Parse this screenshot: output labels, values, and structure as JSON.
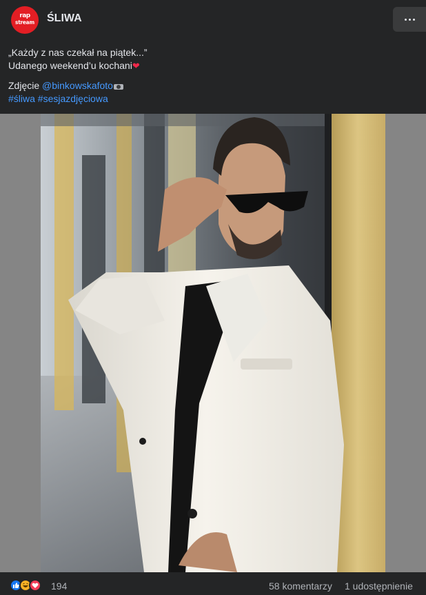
{
  "page": {
    "name": "ŚLIWA",
    "avatar_line1": "rap",
    "avatar_line2": "stream"
  },
  "post": {
    "line1": "„Każdy z nas czekał na piątek...”",
    "line2_text": "Udanego weekend’u kochani",
    "line2_emoji": "heart-emoji",
    "photo_prefix": "Zdjęcie ",
    "photo_mention": "@binkowskafoto",
    "photo_emoji": "camera-emoji",
    "hashtag1": "#śliwa",
    "hashtag2": "#sesjazdjęciowa"
  },
  "stats": {
    "reaction_icons": [
      "like-reaction-icon",
      "haha-reaction-icon",
      "love-reaction-icon"
    ],
    "reaction_count": "194",
    "comments": "58 komentarzy",
    "shares": "1 udostępnienie"
  },
  "colors": {
    "background": "#242526",
    "text": "#e4e6eb",
    "link": "#4599ff",
    "secondary_text": "#b0b3b8",
    "avatar_red": "#e31e24"
  }
}
